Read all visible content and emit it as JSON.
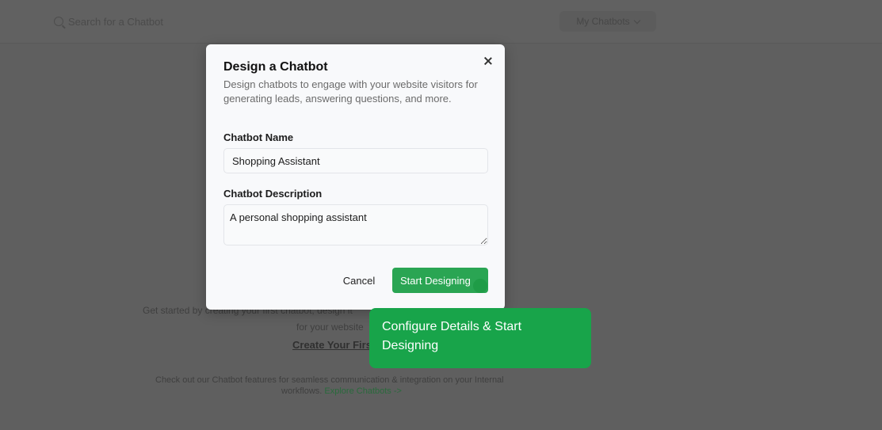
{
  "background": {
    "search_placeholder": "Search for a Chatbot",
    "my_chatbots_label": "My Chatbots",
    "text_line1": "Get started by creating your first chatbot, design it",
    "text_line2": "for your website",
    "create_link": "Create Your First",
    "text_line3": "Check out our Chatbot features for seamless communication & integration on your Internal",
    "text_line4_prefix": "workflows.",
    "text_line4_link": "Explore Chatbots ->"
  },
  "modal": {
    "title": "Design a Chatbot",
    "description": "Design chatbots to engage with your website visitors for generating leads, answering questions, and more.",
    "name_label": "Chatbot Name",
    "name_value": "Shopping Assistant",
    "description_label": "Chatbot Description",
    "description_value": "A personal shopping assistant",
    "cancel_label": "Cancel",
    "start_label": "Start Designing"
  },
  "tooltip": {
    "text": "Configure Details & Start Designing"
  },
  "colors": {
    "primary_green": "#2aa553",
    "tooltip_green": "#18a44a",
    "overlay": "#5f5f5f"
  }
}
